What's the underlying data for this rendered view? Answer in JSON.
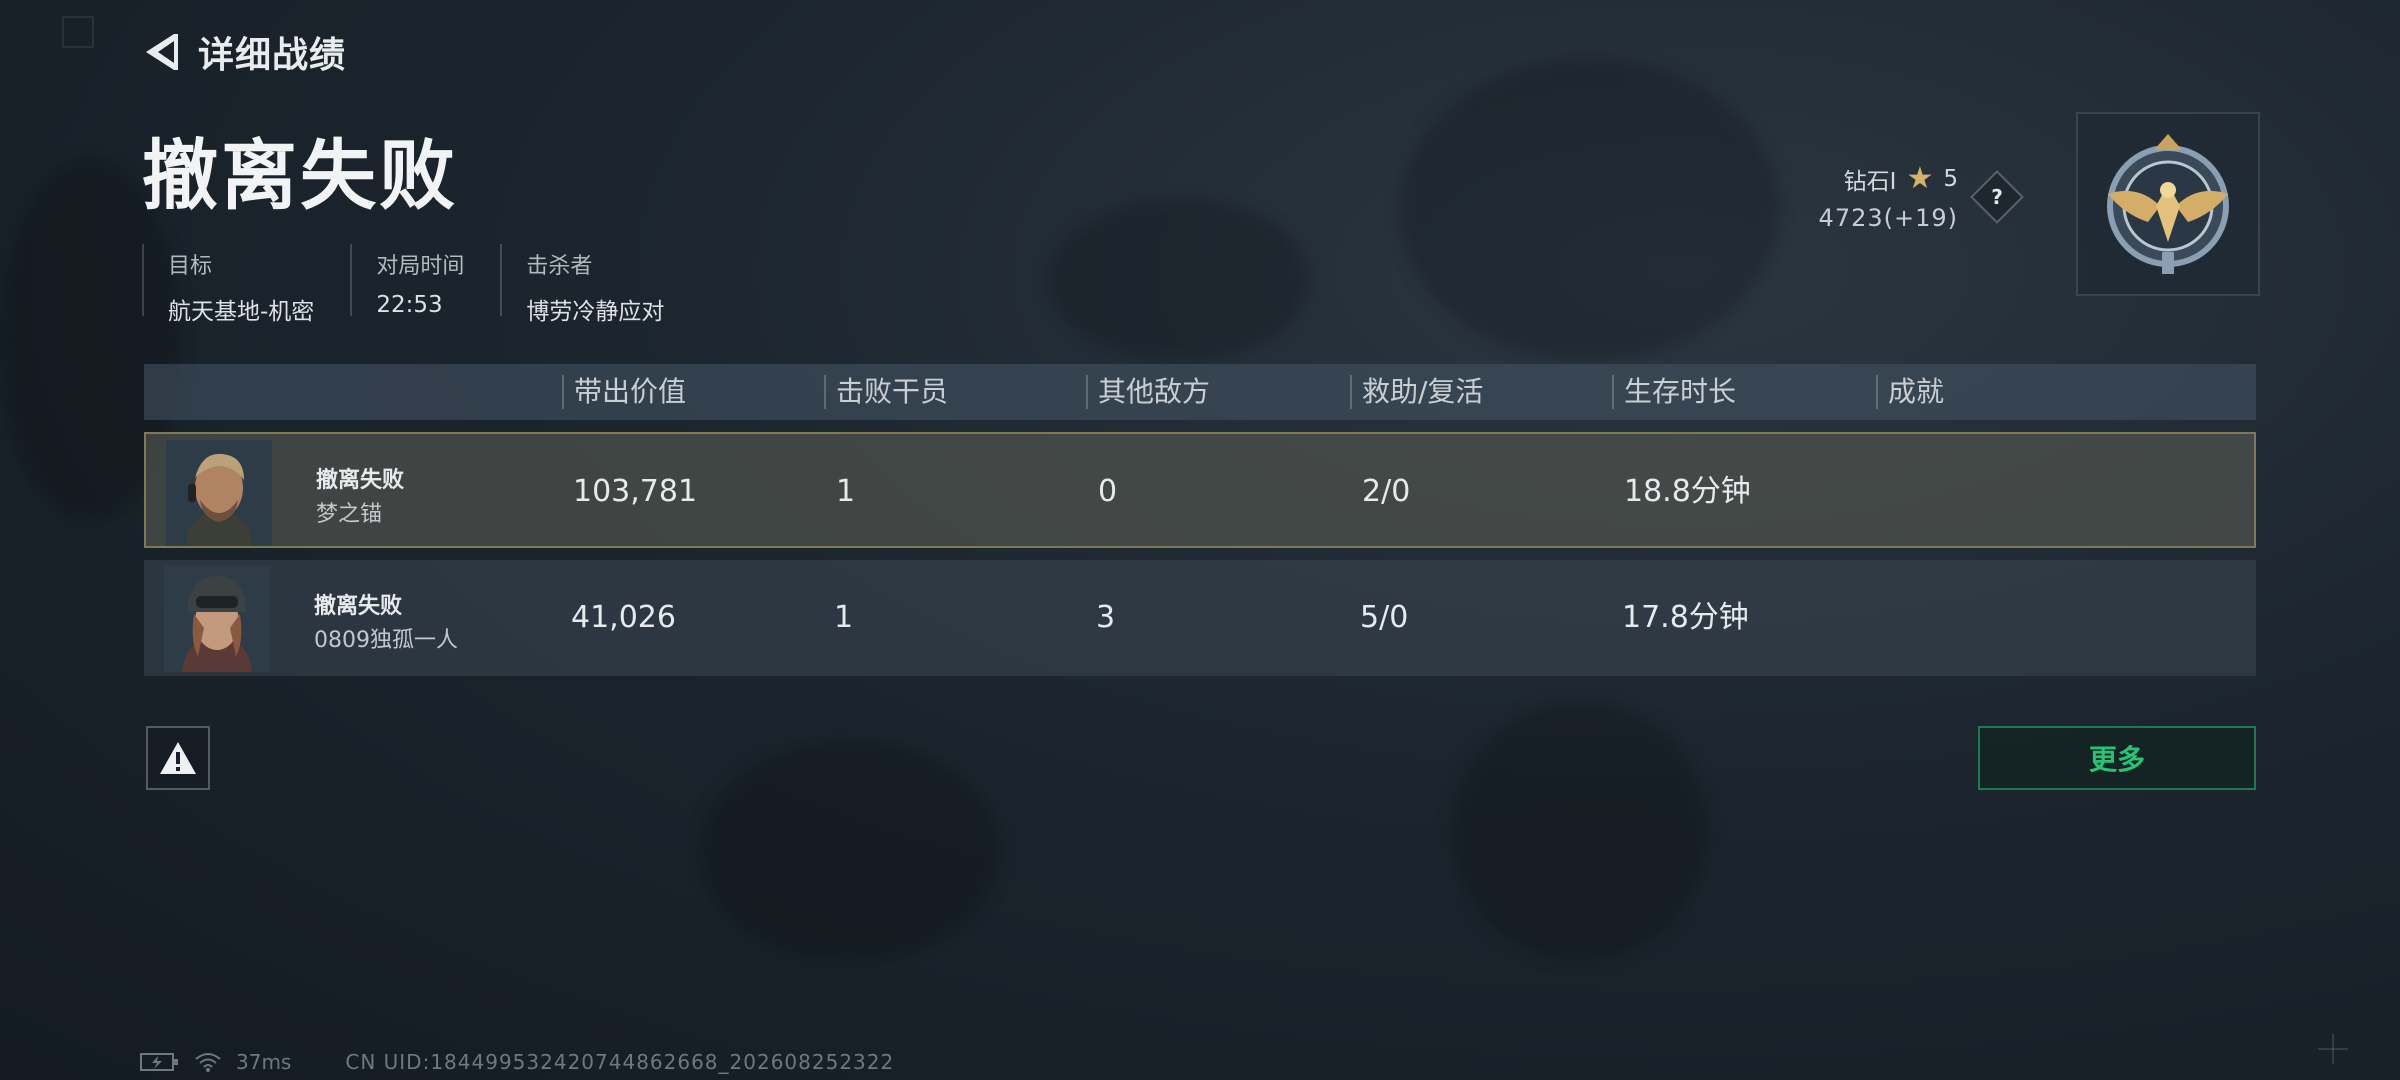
{
  "header": {
    "back_title": "详细战绩"
  },
  "result": {
    "title": "撤离失败"
  },
  "info": [
    {
      "label": "目标",
      "value": "航天基地-机密"
    },
    {
      "label": "对局时间",
      "value": "22:53"
    },
    {
      "label": "击杀者",
      "value": "博劳冷静应对"
    }
  ],
  "rank": {
    "tier": "钻石I",
    "stars": "5",
    "score": "4723(+19)"
  },
  "table": {
    "headers": [
      "带出价值",
      "击败干员",
      "其他敌方",
      "救助/复活",
      "生存时长",
      "成就"
    ],
    "rows": [
      {
        "status": "撤离失败",
        "name": "梦之锚",
        "value": "103,781",
        "kills": "1",
        "other": "0",
        "assist": "2/0",
        "survival": "18.8分钟",
        "achievement": ""
      },
      {
        "status": "撤离失败",
        "name": "0809独孤一人",
        "value": "41,026",
        "kills": "1",
        "other": "3",
        "assist": "5/0",
        "survival": "17.8分钟",
        "achievement": ""
      }
    ]
  },
  "buttons": {
    "more": "更多"
  },
  "status_bar": {
    "ping": "37ms",
    "uid": "CN UID:184499532420744862668_202608252322"
  },
  "colors": {
    "accent_green": "#27c476",
    "gold": "#d2b46a",
    "selected_border": "#7d7a5a"
  }
}
